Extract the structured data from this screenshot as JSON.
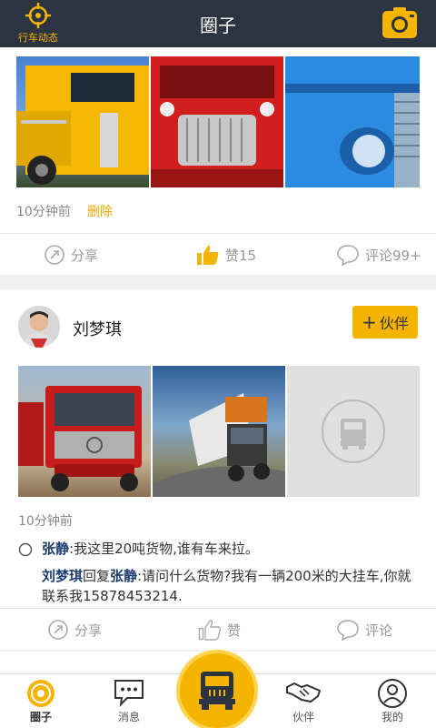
{
  "header": {
    "left_label": "行车动态",
    "title": "圈子"
  },
  "post1": {
    "time": "10分钟前",
    "delete_label": "删除",
    "share_label": "分享",
    "like_label": "赞15",
    "comment_label": "评论99+"
  },
  "post2": {
    "user_name": "刘梦琪",
    "partner_button": "伙伴",
    "time": "10分钟前",
    "comment1_name": "张静",
    "comment1_text": ":我这里20吨货物,谁有车来拉。",
    "reply_name": "刘梦琪",
    "reply_mid": "回复",
    "reply_target": "张静",
    "reply_text": ":请问什么货物?我有一辆200米的大挂车,你就联系我15878453214.",
    "share_label": "分享",
    "like_label": "赞",
    "comment_label": "评论"
  },
  "tabbar": {
    "tabs": [
      {
        "label": "圈子",
        "icon": "circle-target-icon",
        "active": true
      },
      {
        "label": "消息",
        "icon": "message-icon",
        "active": false
      },
      {
        "label": "伙伴",
        "icon": "handshake-icon",
        "active": false
      },
      {
        "label": "我的",
        "icon": "profile-icon",
        "active": false
      }
    ],
    "center_icon": "truck-icon"
  },
  "colors": {
    "accent": "#f5b400",
    "header_bg": "#2d3441",
    "comment_name": "#1f3c6e"
  }
}
